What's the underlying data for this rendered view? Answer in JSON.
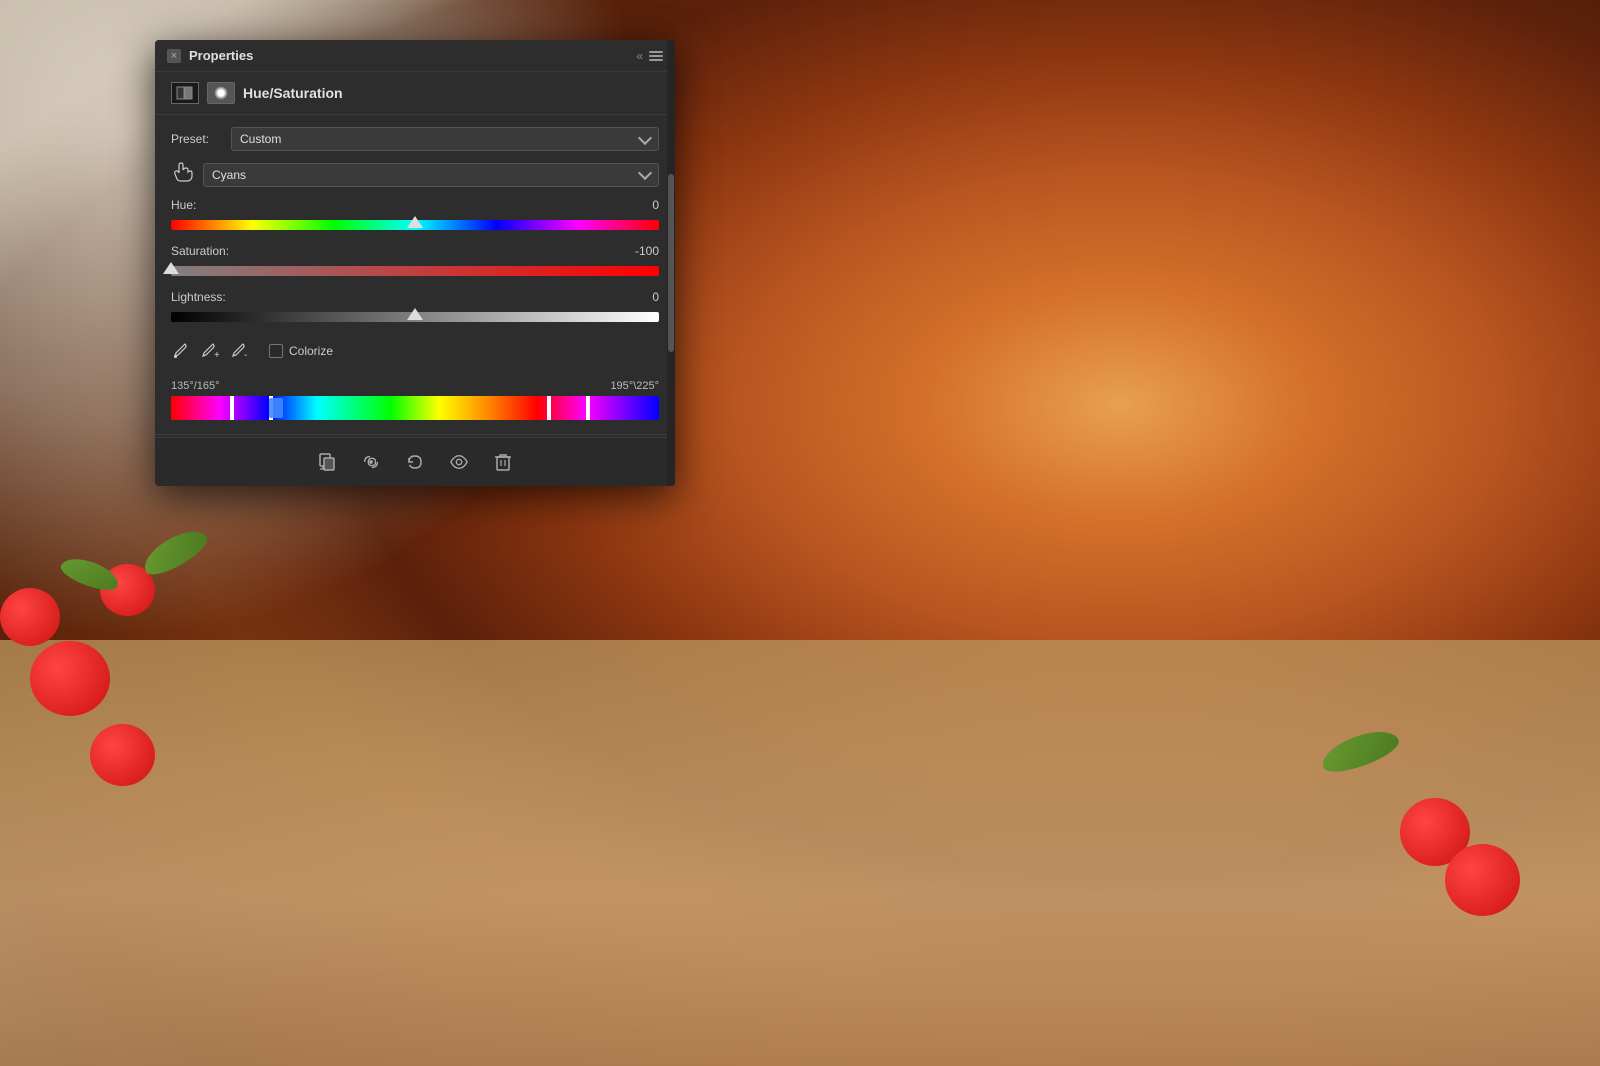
{
  "background": {
    "description": "Pizza with tomatoes and herbs on wooden board"
  },
  "panel": {
    "title": "Properties",
    "close_label": "×",
    "section_title": "Hue/Saturation",
    "preset_label": "Preset:",
    "preset_value": "Custom",
    "channel_value": "Cyans",
    "hue_label": "Hue:",
    "hue_value": "0",
    "saturation_label": "Saturation:",
    "saturation_value": "-100",
    "lightness_label": "Lightness:",
    "lightness_value": "0",
    "colorize_label": "Colorize",
    "range_left_label": "135°/165°",
    "range_right_label": "195°\\225°",
    "hue_slider_pct": 50,
    "saturation_slider_pct": 0,
    "lightness_slider_pct": 50,
    "bottom_buttons": [
      {
        "name": "clip-to-layer",
        "symbol": "⬛"
      },
      {
        "name": "visibility-link",
        "symbol": "♾"
      },
      {
        "name": "reset",
        "symbol": "↺"
      },
      {
        "name": "visibility",
        "symbol": "👁"
      },
      {
        "name": "delete",
        "symbol": "🗑"
      }
    ]
  }
}
